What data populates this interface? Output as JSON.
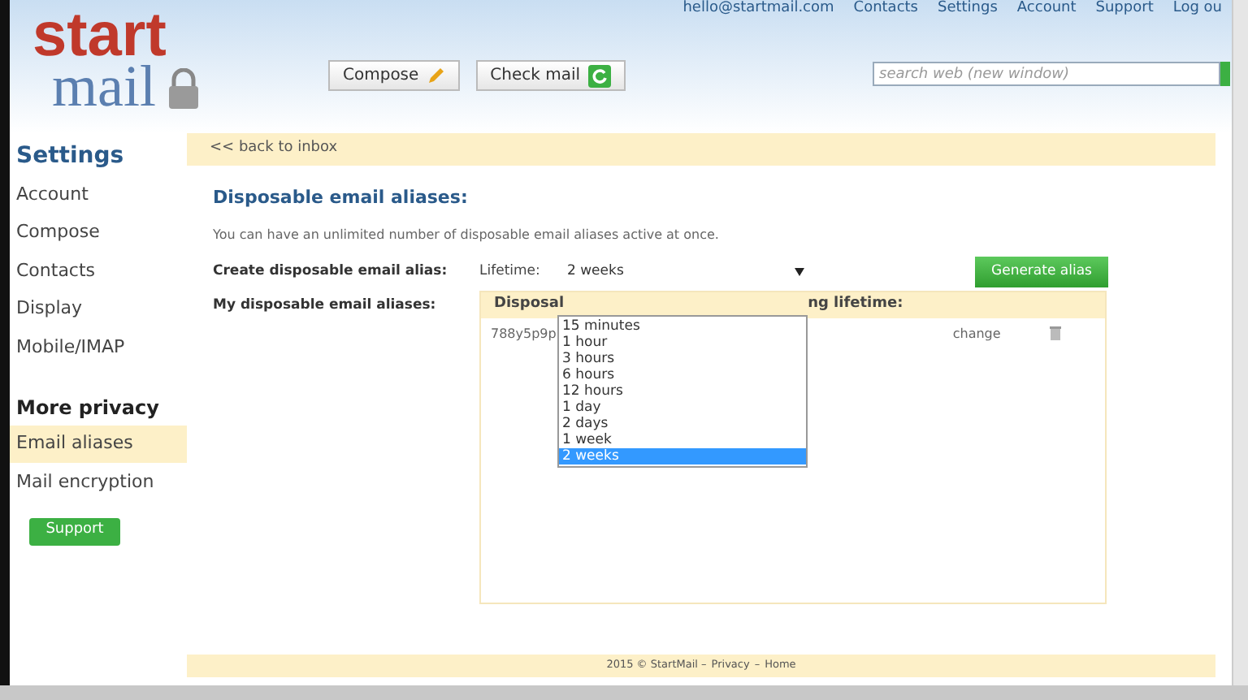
{
  "top_links": [
    "hello@startmail.com",
    "Contacts",
    "Settings",
    "Account",
    "Support",
    "Log ou"
  ],
  "logo": {
    "line1": "start",
    "line2": "mail"
  },
  "toolbar": [
    {
      "label": "Compose",
      "kind": "compose"
    },
    {
      "label": "Check mail",
      "kind": "check"
    }
  ],
  "search": {
    "placeholder": "search web (new window)"
  },
  "sidebar": {
    "title": "Settings",
    "items": [
      {
        "label": "Account",
        "selected": false
      },
      {
        "label": "Compose",
        "selected": false
      },
      {
        "label": "Contacts",
        "selected": false
      },
      {
        "label": "Display",
        "selected": false
      },
      {
        "label": "Mobile/IMAP",
        "selected": false
      }
    ],
    "section": "More privacy",
    "section_items": [
      {
        "label": "Email aliases",
        "selected": true
      },
      {
        "label": "Mail encryption",
        "selected": false
      }
    ],
    "support_button": "Support"
  },
  "back_link": "<< back to inbox",
  "heading": "Disposable email aliases:",
  "description": "You can have an unlimited number of disposable email aliases active at once.",
  "create_label": "Create disposable email alias:",
  "lifetime_label": "Lifetime:",
  "lifetime_value": "2 weeks",
  "lifetime_options": [
    {
      "label": "15 minutes",
      "selected": false
    },
    {
      "label": "1 hour",
      "selected": false
    },
    {
      "label": "3 hours",
      "selected": false
    },
    {
      "label": "6 hours",
      "selected": false
    },
    {
      "label": "12 hours",
      "selected": false
    },
    {
      "label": "1 day",
      "selected": false
    },
    {
      "label": "2 days",
      "selected": false
    },
    {
      "label": "1 week",
      "selected": false
    },
    {
      "label": "2 weeks",
      "selected": true
    }
  ],
  "generate_button": "Generate alias",
  "my_aliases_label": "My disposable email aliases:",
  "table": {
    "header_left": "Disposal",
    "header_right": "ng lifetime:",
    "rows": [
      {
        "alias": "788y5p9p",
        "action": "change"
      }
    ]
  },
  "footer": {
    "copyright": "2015 © StartMail –",
    "links": [
      "Privacy",
      "Home"
    ],
    "separator": "–"
  }
}
